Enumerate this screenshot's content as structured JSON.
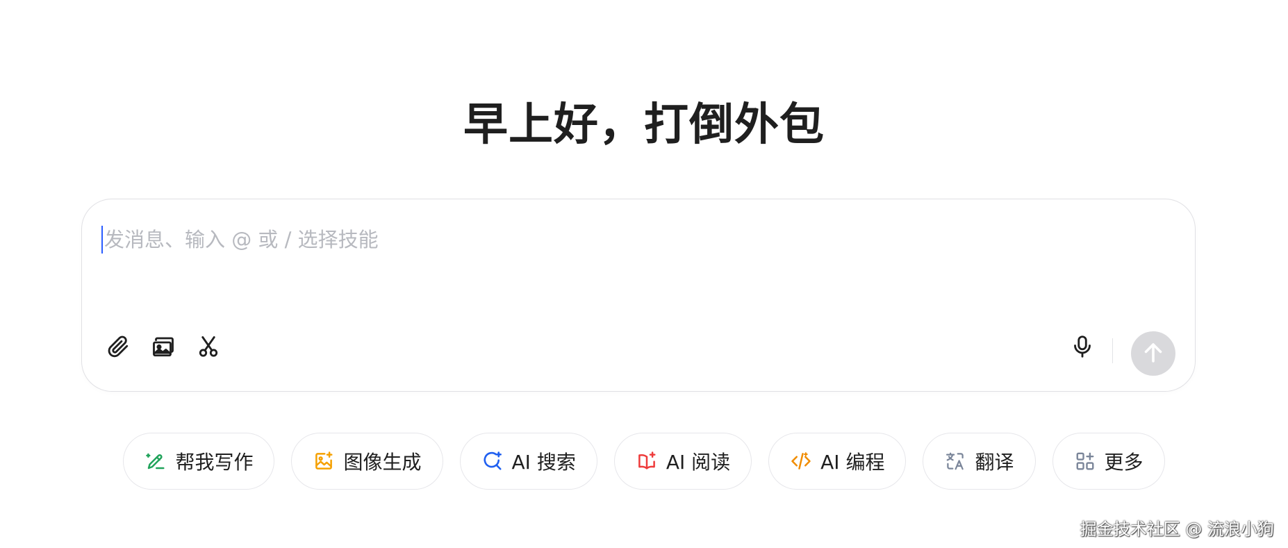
{
  "greeting": "早上好，打倒外包",
  "composer": {
    "placeholder": "发消息、输入 @ 或 / 选择技能",
    "value": "",
    "tools": [
      {
        "icon": "paperclip-icon"
      },
      {
        "icon": "image-stack-icon"
      },
      {
        "icon": "scissors-icon"
      }
    ],
    "mic_icon": "microphone-icon",
    "send_icon": "arrow-up-icon"
  },
  "skills": [
    {
      "label": "帮我写作",
      "icon": "pen-sparkle-icon",
      "color": "#21a35b"
    },
    {
      "label": "图像生成",
      "icon": "image-sparkle-icon",
      "color": "#f5a000"
    },
    {
      "label": "AI 搜索",
      "icon": "search-sparkle-icon",
      "color": "#1f5ff0"
    },
    {
      "label": "AI 阅读",
      "icon": "book-sparkle-icon",
      "color": "#ee3b3b"
    },
    {
      "label": "AI 编程",
      "icon": "code-icon",
      "color": "#f08c00"
    },
    {
      "label": "翻译",
      "icon": "translate-icon",
      "color": "#7a8599"
    },
    {
      "label": "更多",
      "icon": "grid-plus-icon",
      "color": "#7a8599"
    }
  ],
  "watermark": "掘金技术社区 @ 流浪小狗",
  "colors": {
    "send_button_disabled": "#d9d9dc",
    "caret": "#2a5cff",
    "placeholder": "#b7b9bf"
  }
}
